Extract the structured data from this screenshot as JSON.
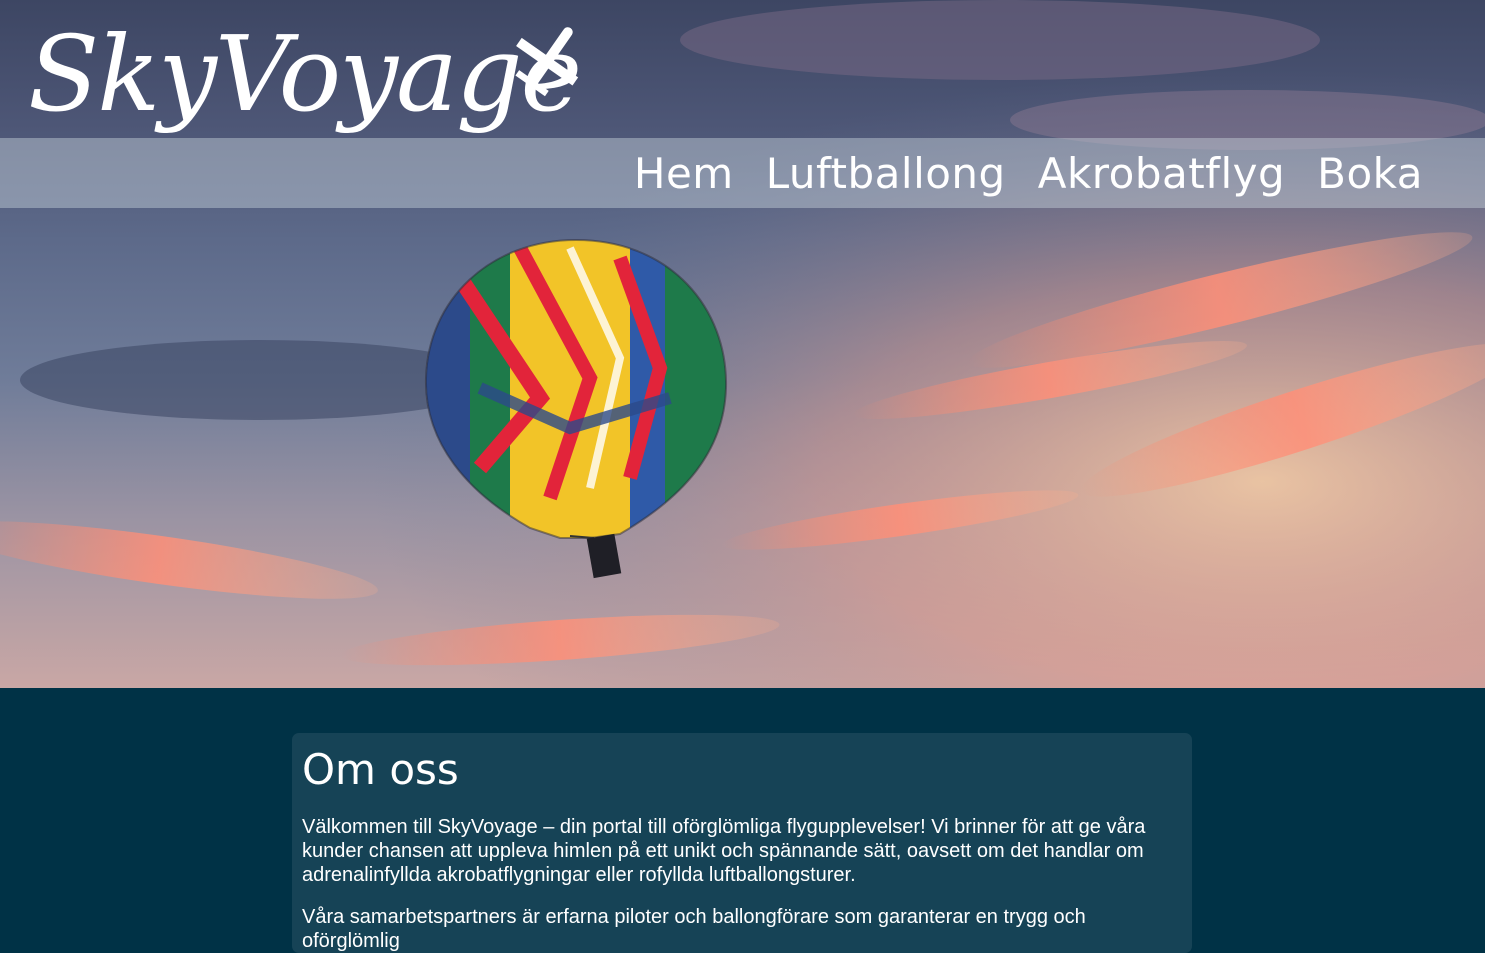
{
  "header": {
    "logo_text": "SkyVoyage",
    "logo_icon": "airplane-icon"
  },
  "nav": {
    "items": [
      {
        "label": "Hem"
      },
      {
        "label": "Luftballong"
      },
      {
        "label": "Akrobatflyg"
      },
      {
        "label": "Boka"
      }
    ]
  },
  "hero": {
    "image": "hot-air-balloon-sunset-sky"
  },
  "about": {
    "title": "Om oss",
    "paragraph1": "Välkommen till SkyVoyage – din portal till oförglömliga flygupplevelser! Vi brinner för att ge våra kunder chansen att uppleva himlen på ett unikt och spännande sätt, oavsett om det handlar om adrenalinfyllda akrobatflygningar eller rofyllda luftballongsturer.",
    "paragraph2": "Våra samarbetspartners är erfarna piloter och ballongförare som garanterar en trygg och oförglömlig"
  },
  "colors": {
    "page_bg": "#003246",
    "card_bg": "#164356",
    "nav_bg": "rgba(200,210,220,0.45)",
    "text": "#ffffff"
  }
}
